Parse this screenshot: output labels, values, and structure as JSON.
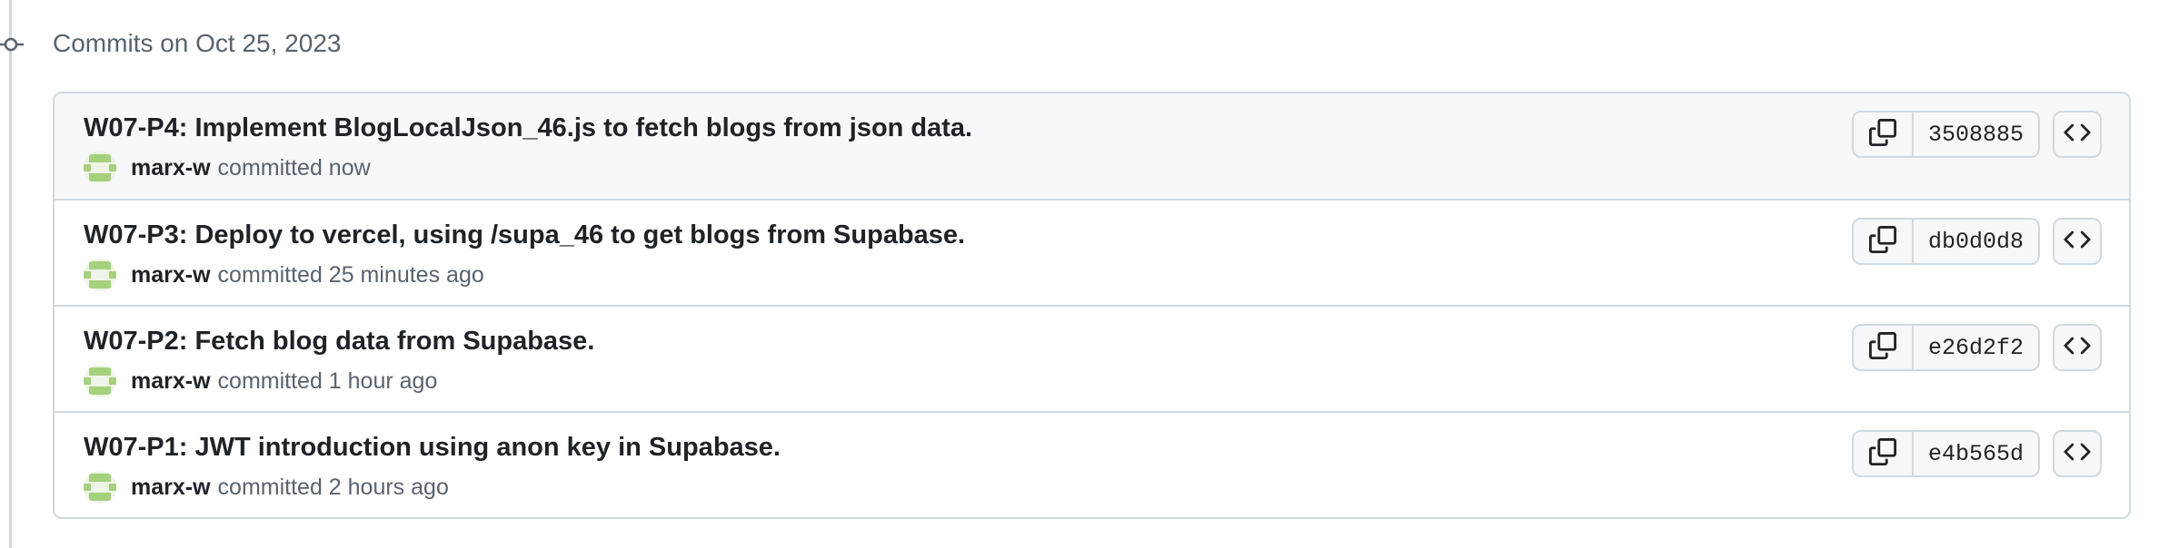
{
  "group": {
    "date_label": "Commits on Oct 25, 2023"
  },
  "colors": {
    "avatar_green": "#a5d07c",
    "border": "#d1d9e0",
    "muted_text": "#59636e"
  },
  "commits": [
    {
      "title": "W07-P4: Implement BlogLocalJson_46.js to fetch blogs from json data.",
      "author": "marx-w",
      "committed_text": "committed now",
      "sha": "3508885"
    },
    {
      "title": "W07-P3: Deploy to vercel, using /supa_46 to get blogs from Supabase.",
      "author": "marx-w",
      "committed_text": "committed 25 minutes ago",
      "sha": "db0d0d8"
    },
    {
      "title": "W07-P2: Fetch blog data from Supabase.",
      "author": "marx-w",
      "committed_text": "committed 1 hour ago",
      "sha": "e26d2f2"
    },
    {
      "title": "W07-P1: JWT introduction using anon key in Supabase.",
      "author": "marx-w",
      "committed_text": "committed 2 hours ago",
      "sha": "e4b565d"
    }
  ],
  "icons": {
    "timeline": "git-commit-icon",
    "copy": "copy-icon",
    "browse": "code-icon",
    "avatar": "identicon-avatar"
  }
}
